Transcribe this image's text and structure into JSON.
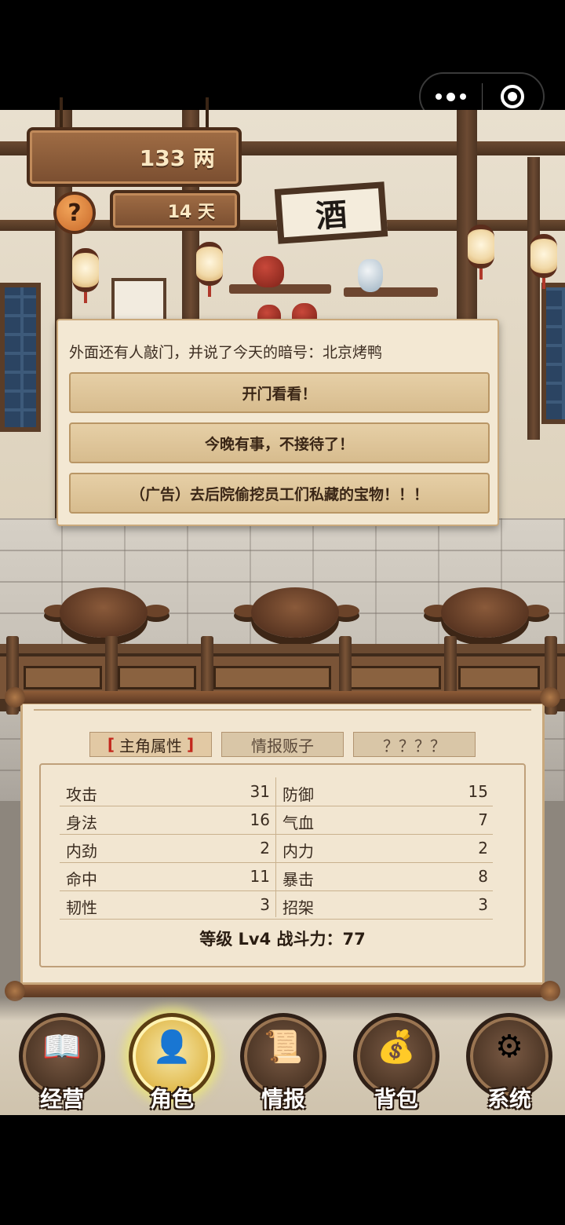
{
  "hud": {
    "money": "133 两",
    "day": "14 天",
    "help": "?"
  },
  "scene": {
    "sign": "酒"
  },
  "dialog": {
    "message": "外面还有人敲门，并说了今天的暗号：北京烤鸭",
    "options": [
      "开门看看！",
      "今晚有事，不接待了！",
      "（广告）去后院偷挖员工们私藏的宝物！！！"
    ]
  },
  "tabs": [
    {
      "label": "主角属性",
      "bracket_left": "[",
      "bracket_right": "]"
    },
    {
      "label": "情报贩子"
    },
    {
      "label": "？？？？"
    }
  ],
  "stats": [
    {
      "l_name": "攻击",
      "l_val": "31",
      "r_name": "防御",
      "r_val": "15"
    },
    {
      "l_name": "身法",
      "l_val": "16",
      "r_name": "气血",
      "r_val": "7"
    },
    {
      "l_name": "内劲",
      "l_val": "2",
      "r_name": "内力",
      "r_val": "2"
    },
    {
      "l_name": "命中",
      "l_val": "11",
      "r_name": "暴击",
      "r_val": "8"
    },
    {
      "l_name": "韧性",
      "l_val": "3",
      "r_name": "招架",
      "r_val": "3"
    }
  ],
  "summary": "等级 Lv4   战斗力：77",
  "nav": [
    {
      "label": "经营",
      "icon": "ledger-abacus-icon"
    },
    {
      "label": "角色",
      "icon": "character-portrait-icon"
    },
    {
      "label": "情报",
      "icon": "scroll-icon"
    },
    {
      "label": "背包",
      "icon": "bag-icon"
    },
    {
      "label": "系统",
      "icon": "gear-icon"
    }
  ]
}
